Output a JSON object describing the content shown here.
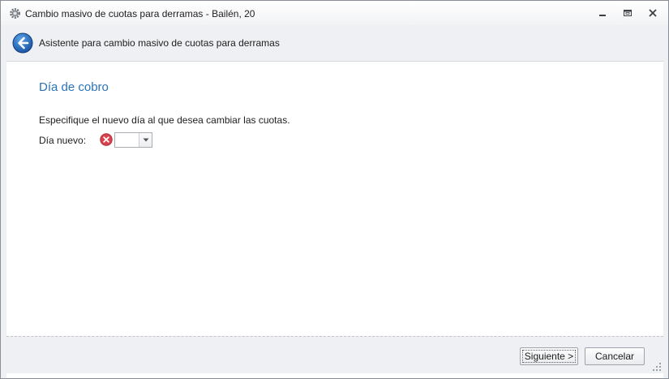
{
  "window": {
    "title": "Cambio masivo de cuotas para derramas - Bailén, 20",
    "app_icon": "gear-icon",
    "controls": [
      "minimize-icon",
      "maximize-icon",
      "close-icon"
    ]
  },
  "header": {
    "back_icon": "back-arrow-icon",
    "title": "Asistente para cambio masivo de cuotas para derramas"
  },
  "content": {
    "section_title": "Día de cobro",
    "instructions": "Especifique el nuevo día al que desea cambiar las cuotas.",
    "field_label": "Día nuevo:",
    "field_value": "",
    "error_icon": "error-x-icon"
  },
  "footer": {
    "next_label": "Siguiente >",
    "cancel_label": "Cancelar"
  },
  "colors": {
    "accent": "#2a73b8",
    "error": "#d9414e",
    "band": "#eef0f3"
  }
}
